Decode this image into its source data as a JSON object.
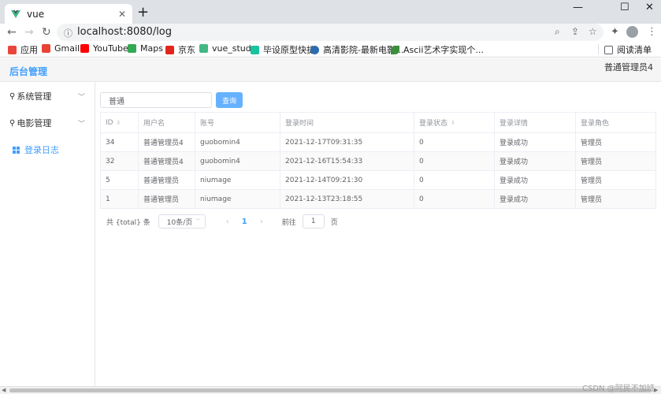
{
  "browser": {
    "tab_title": "vue",
    "tab_close": "✕",
    "new_tab": "+",
    "win_min": "—",
    "win_max": "☐",
    "win_close": "✕",
    "back": "←",
    "forward": "→",
    "reload": "↻",
    "url": "localhost:8080/log",
    "bookmarks": [
      {
        "label": "应用",
        "color": "#e8453c"
      },
      {
        "label": "Gmail",
        "color": "#ea4335"
      },
      {
        "label": "YouTube",
        "color": "#ff0000"
      },
      {
        "label": "Maps",
        "color": "#34a853"
      },
      {
        "label": "京东",
        "color": "#e1251b"
      },
      {
        "label": "vue_study",
        "color": "#42b883"
      },
      {
        "label": "毕设原型快捷",
        "color": "#18c39e"
      },
      {
        "label": "高清影院-最新电影...",
        "color": "#2b6cb0"
      },
      {
        "label": "Ascii艺术字实现个...",
        "color": "#3c8d3c"
      }
    ],
    "reading_list": "阅读清单"
  },
  "app": {
    "title": "后台管理",
    "user": "普通管理员4",
    "menu": [
      {
        "label": "系统管理"
      },
      {
        "label": "电影管理"
      },
      {
        "label": "登录日志"
      }
    ],
    "search": {
      "value": "普通",
      "button": "查询"
    },
    "table": {
      "columns": [
        "ID",
        "用户名",
        "账号",
        "登录时间",
        "登录状态",
        "登录详情",
        "登录角色"
      ],
      "rows": [
        [
          "34",
          "普通管理员4",
          "guobomin4",
          "2021-12-17T09:31:35",
          "0",
          "登录成功",
          "管理员"
        ],
        [
          "32",
          "普通管理员4",
          "guobomin4",
          "2021-12-16T15:54:33",
          "0",
          "登录成功",
          "管理员"
        ],
        [
          "5",
          "普通管理员",
          "niumage",
          "2021-12-14T09:21:30",
          "0",
          "登录成功",
          "管理员"
        ],
        [
          "1",
          "普通管理员",
          "niumage",
          "2021-12-13T23:18:55",
          "0",
          "登录成功",
          "管理员"
        ]
      ]
    },
    "pagination": {
      "total": "共 {total} 条",
      "page_size": "10条/页",
      "prev": "‹",
      "current": "1",
      "next": "›",
      "goto_label": "前往",
      "goto_value": "1",
      "page_unit": "页"
    }
  },
  "watermark": "CSDN @阿民不加班"
}
